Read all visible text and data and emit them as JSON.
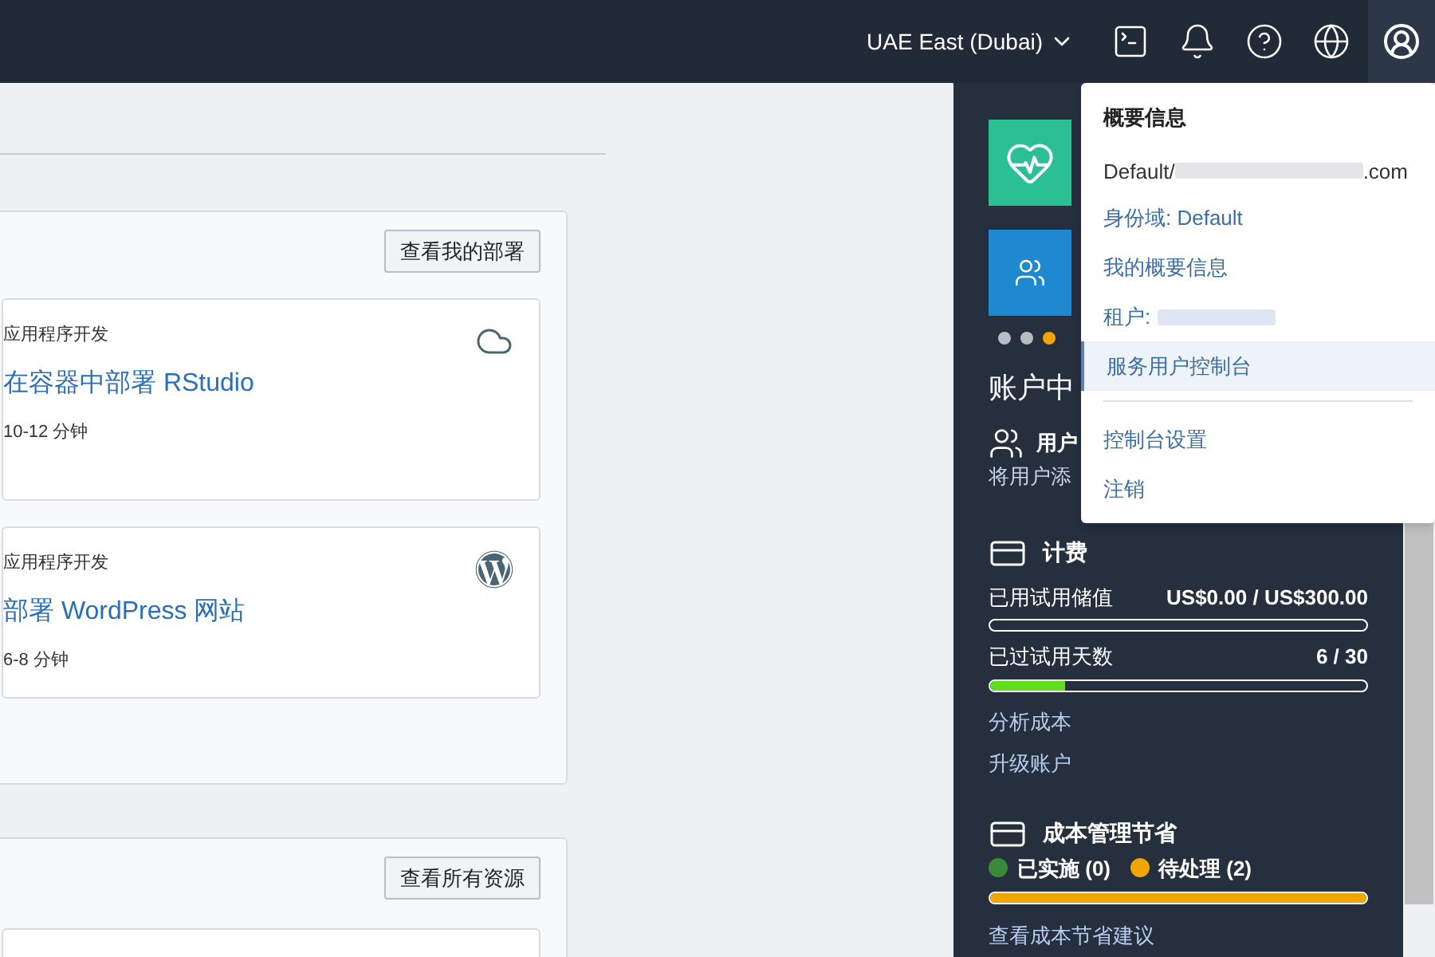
{
  "top_bar": {
    "region": "UAE East (Dubai)",
    "account_button": {
      "selected": true
    }
  },
  "deployments_panel": {
    "button": "查看我的部署",
    "cards": [
      {
        "category": "应用程序开发",
        "title": "在容器中部署 RStudio",
        "duration": "10-12 分钟",
        "kind": "cloud"
      },
      {
        "category": "应用程序开发",
        "title": "部署 WordPress 网站",
        "duration": "6-8 分钟",
        "kind": "wordpress"
      }
    ]
  },
  "resources_panel": {
    "button": "查看所有资源"
  },
  "side_panel": {
    "tiles": [
      {
        "kind": "health"
      },
      {
        "kind": "users"
      }
    ],
    "dots": [
      {
        "selected": false
      },
      {
        "selected": false
      },
      {
        "selected": true
      }
    ],
    "heading": "账户中",
    "users": {
      "title": "用户",
      "description": "将用户添"
    },
    "billing": {
      "title": "计费",
      "meters": [
        {
          "label": "已用试用储值",
          "reading": "US$0.00 / US$300.00",
          "level": 0
        },
        {
          "label": "已过试用天数",
          "reading": "6 / 30",
          "level": 0.2
        }
      ],
      "links": [
        "分析成本",
        "升级账户"
      ]
    },
    "savings": {
      "title": "成本管理节省",
      "statuses": [
        {
          "label": "已实施 (0)",
          "color": "#3a8a3a"
        },
        {
          "label": "待处理 (2)",
          "color": "#f0a500"
        }
      ],
      "level": 1,
      "link": "查看成本节省建议"
    }
  },
  "user_menu": {
    "title": "概要信息",
    "account_prefix": "Default/",
    "account_suffix": ".com",
    "groups": [
      [
        {
          "kind": "link",
          "label": "身份域: Default",
          "selected": false
        },
        {
          "kind": "link",
          "label": "我的概要信息",
          "selected": false
        },
        {
          "kind": "tenant",
          "label": "租户:",
          "selected": false
        },
        {
          "kind": "link",
          "label": "服务用户控制台",
          "selected": true
        }
      ],
      [
        {
          "kind": "link",
          "label": "控制台设置",
          "selected": false
        },
        {
          "kind": "link",
          "label": "注销",
          "selected": false
        }
      ]
    ]
  }
}
